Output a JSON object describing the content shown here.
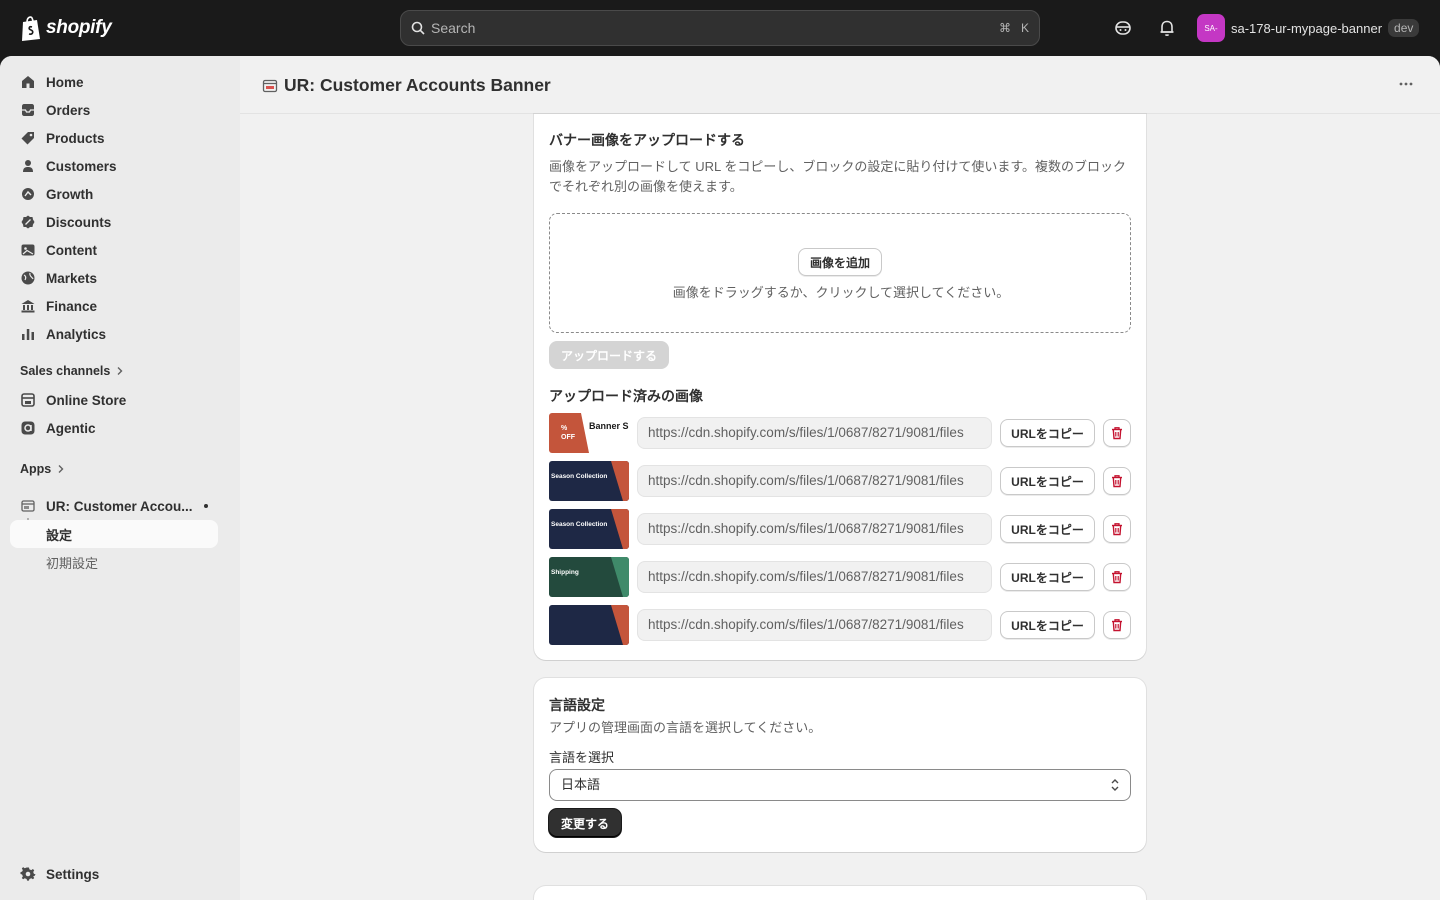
{
  "topbar": {
    "logo_text": "shopify",
    "search_placeholder": "Search",
    "shortcut_cmd": "⌘",
    "shortcut_key": "K",
    "avatar_initials": "SA-",
    "store_name": "sa-178-ur-mypage-banner",
    "store_badge": "dev"
  },
  "sidebar": {
    "items": [
      {
        "label": "Home",
        "icon": "home-icon"
      },
      {
        "label": "Orders",
        "icon": "orders-icon"
      },
      {
        "label": "Products",
        "icon": "products-icon"
      },
      {
        "label": "Customers",
        "icon": "customers-icon"
      },
      {
        "label": "Growth",
        "icon": "growth-icon"
      },
      {
        "label": "Discounts",
        "icon": "discounts-icon"
      },
      {
        "label": "Content",
        "icon": "content-icon"
      },
      {
        "label": "Markets",
        "icon": "markets-icon"
      },
      {
        "label": "Finance",
        "icon": "finance-icon"
      },
      {
        "label": "Analytics",
        "icon": "analytics-icon"
      }
    ],
    "sales_channels_label": "Sales channels",
    "channels": [
      {
        "label": "Online Store",
        "icon": "online-store-icon"
      },
      {
        "label": "Agentic",
        "icon": "agentic-icon"
      }
    ],
    "apps_label": "Apps",
    "app_name": "UR: Customer Accou...",
    "app_sub_items": [
      "設定",
      "初期設定"
    ],
    "settings_label": "Settings"
  },
  "header": {
    "title": "UR: Customer Accounts Banner"
  },
  "upload_card": {
    "title": "バナー画像をアップロードする",
    "description_line1": "画像をアップロードして URL をコピーし、ブロックの設定に貼り付けて使います。複数のブロック",
    "description_line2": "でそれぞれ別の画像を使えます。",
    "add_image_button": "画像を追加",
    "drop_hint": "画像をドラッグするか、クリックして選択してください。",
    "upload_button": "アップロードする",
    "uploaded_heading": "アップロード済みの画像",
    "copy_label": "URLをコピー",
    "images": [
      {
        "url": "https://cdn.shopify.com/s/files/1/0687/8271/9081/files",
        "thumb_text": "Banner S",
        "thumb_badge": "% OFF",
        "thumb_bg": "#ffffff",
        "thumb_accent": "#c4553b"
      },
      {
        "url": "https://cdn.shopify.com/s/files/1/0687/8271/9081/files",
        "thumb_text": "Season Collection",
        "thumb_badge": "",
        "thumb_bg": "#1e2845",
        "thumb_accent": "#c4553b"
      },
      {
        "url": "https://cdn.shopify.com/s/files/1/0687/8271/9081/files",
        "thumb_text": "Season Collection",
        "thumb_badge": "",
        "thumb_bg": "#1e2845",
        "thumb_accent": "#c4553b"
      },
      {
        "url": "https://cdn.shopify.com/s/files/1/0687/8271/9081/files",
        "thumb_text": "Shipping",
        "thumb_badge": "",
        "thumb_bg": "#234a3d",
        "thumb_accent": "#3f8a6a"
      },
      {
        "url": "https://cdn.shopify.com/s/files/1/0687/8271/9081/files",
        "thumb_text": "",
        "thumb_badge": "",
        "thumb_bg": "#1e2845",
        "thumb_accent": "#c4553b"
      }
    ]
  },
  "language_card": {
    "title": "言語設定",
    "description": "アプリの管理画面の言語を選択してください。",
    "select_label": "言語を選択",
    "selected_value": "日本語",
    "submit_button": "変更する"
  },
  "colors": {
    "topbar_bg": "#1a1a1a",
    "page_bg": "#f1f1f1",
    "sidebar_bg": "#ebebeb",
    "danger": "#c4122f",
    "avatar": "#c437c4"
  }
}
